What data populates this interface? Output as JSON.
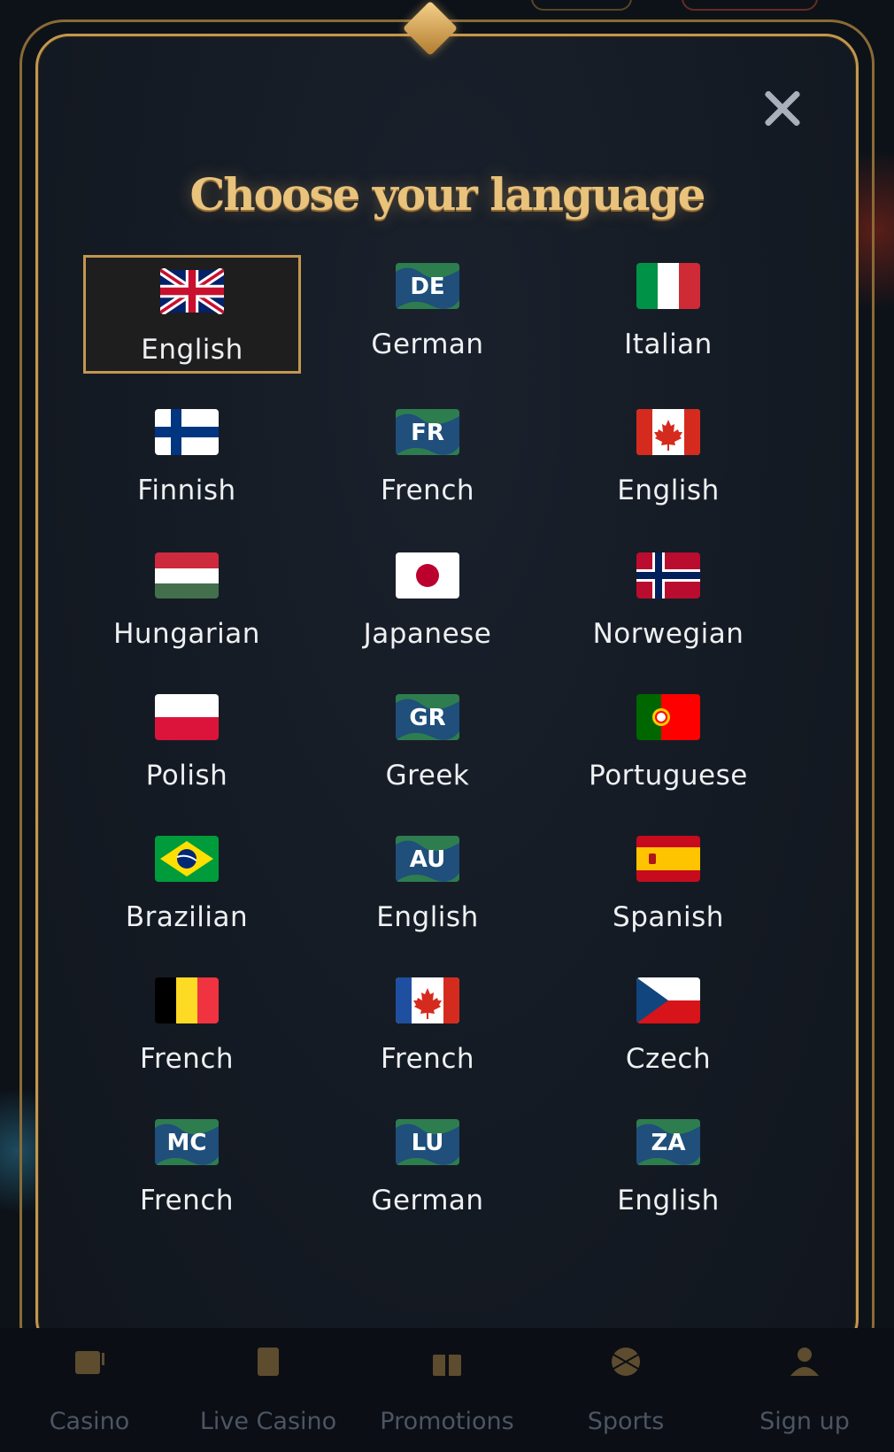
{
  "modal": {
    "title": "Choose your language",
    "close_icon": "close-icon"
  },
  "languages": [
    {
      "label": "English",
      "flag": "uk-flag",
      "selected": true
    },
    {
      "label": "German",
      "flag": "de-badge-flag",
      "code": "DE"
    },
    {
      "label": "Italian",
      "flag": "italy-flag"
    },
    {
      "label": "Finnish",
      "flag": "finland-flag"
    },
    {
      "label": "French",
      "flag": "fr-badge-flag",
      "code": "FR"
    },
    {
      "label": "English",
      "flag": "canada-flag"
    },
    {
      "label": "Hungarian",
      "flag": "hungary-flag"
    },
    {
      "label": "Japanese",
      "flag": "japan-flag"
    },
    {
      "label": "Norwegian",
      "flag": "norway-flag"
    },
    {
      "label": "Polish",
      "flag": "poland-flag"
    },
    {
      "label": "Greek",
      "flag": "gr-badge-flag",
      "code": "GR"
    },
    {
      "label": "Portuguese",
      "flag": "portugal-flag"
    },
    {
      "label": "Brazilian",
      "flag": "brazil-flag"
    },
    {
      "label": "English",
      "flag": "au-badge-flag",
      "code": "AU"
    },
    {
      "label": "Spanish",
      "flag": "spain-flag"
    },
    {
      "label": "French",
      "flag": "belgium-flag"
    },
    {
      "label": "French",
      "flag": "canada-flag"
    },
    {
      "label": "Czech",
      "flag": "czech-flag"
    },
    {
      "label": "French",
      "flag": "mc-badge-flag",
      "code": "MC"
    },
    {
      "label": "German",
      "flag": "lu-badge-flag",
      "code": "LU"
    },
    {
      "label": "English",
      "flag": "za-badge-flag",
      "code": "ZA"
    }
  ],
  "bottom_nav": [
    {
      "label": "Casino",
      "icon": "slot-machine-icon"
    },
    {
      "label": "Live Casino",
      "icon": "cards-icon"
    },
    {
      "label": "Promotions",
      "icon": "gift-icon"
    },
    {
      "label": "Sports",
      "icon": "ball-icon"
    },
    {
      "label": "Sign up",
      "icon": "user-icon"
    }
  ],
  "colors": {
    "gold": "#c2974f",
    "title_gold": "#e9c27c",
    "modal_bg": "#141a23",
    "text": "#eef0f2",
    "nav_text": "#4c5563"
  }
}
